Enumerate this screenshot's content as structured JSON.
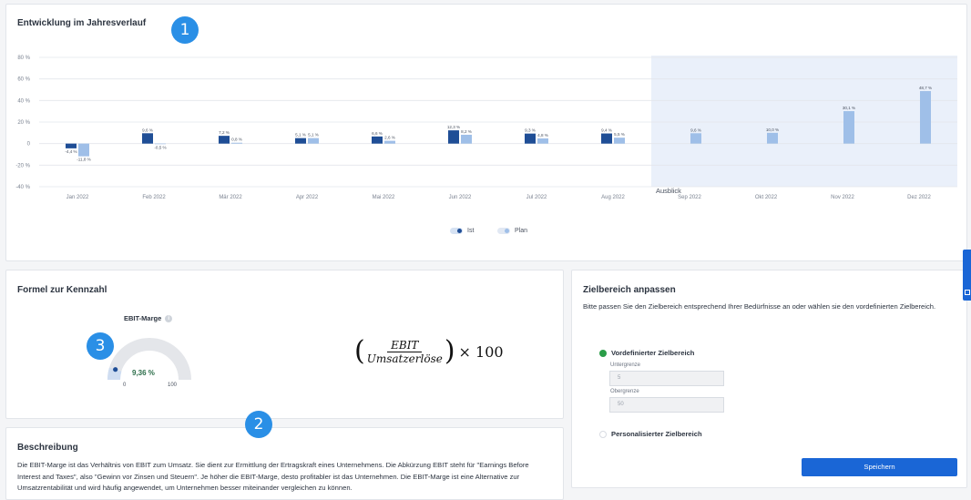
{
  "chart_section": {
    "title": "Entwicklung im Jahresverlauf",
    "badge": "1",
    "outlook_label": "Ausblick",
    "legend": [
      {
        "label": "Ist",
        "color": "#1f4e96"
      },
      {
        "label": "Plan",
        "color": "#9fbfe8"
      }
    ]
  },
  "chart_data": {
    "type": "bar",
    "title": "Entwicklung im Jahresverlauf",
    "categories": [
      "Jan 2022",
      "Feb 2022",
      "Mär 2022",
      "Apr 2022",
      "Mai 2022",
      "Jun 2022",
      "Jul 2022",
      "Aug 2022",
      "Sep 2022",
      "Okt 2022",
      "Nov 2022",
      "Dez 2022"
    ],
    "y_ticks": [
      "80 %",
      "60 %",
      "40 %",
      "20 %",
      "0",
      "-20 %",
      "-40 %"
    ],
    "ylim": [
      -40,
      80
    ],
    "series": [
      {
        "name": "Ist",
        "color": "#1f4e96",
        "values": [
          -4.4,
          9.6,
          7.2,
          5.1,
          6.6,
          12.3,
          9.3,
          9.4,
          null,
          null,
          null,
          null
        ],
        "labels": [
          "-4,4 %",
          "9,6 %",
          "7,2 %",
          "5,1 %",
          "6,6 %",
          "12,3 %",
          "9,3 %",
          "9,4 %",
          "",
          "",
          "",
          ""
        ]
      },
      {
        "name": "Plan",
        "color": "#9fbfe8",
        "values": [
          -11.8,
          -0.5,
          0.8,
          5.1,
          2.6,
          8.2,
          4.8,
          5.5,
          9.6,
          10.0,
          30.1,
          48.7
        ],
        "labels": [
          "-11,8 %",
          "-0,5 %",
          "0,8 %",
          "5,1 %",
          "2,6 %",
          "8,2 %",
          "4,8 %",
          "5,5 %",
          "9,6 %",
          "10,0 %",
          "30,1 %",
          "48,7 %"
        ]
      }
    ],
    "outlook_from": "Sep 2022",
    "grid": true,
    "legend_position": "bottom-center"
  },
  "formula_section": {
    "title": "Formel zur Kennzahl",
    "badge": "3",
    "gauge": {
      "label": "EBIT-Marge",
      "value_text": "9,36 %",
      "value": 9.36,
      "min": "0",
      "max": "100"
    },
    "formula": {
      "numerator": "EBIT",
      "denominator": "Umsatzerlöse",
      "multiplier": "× 100"
    }
  },
  "description_section": {
    "title": "Beschreibung",
    "badge": "2",
    "text": "Die EBIT-Marge ist das Verhältnis von EBIT zum Umsatz. Sie dient zur Ermittlung der Ertragskraft eines Unternehmens. Die Abkürzung EBIT steht für \"Earnings Before Interest and Taxes\", also \"Gewinn vor Zinsen und Steuern\". Je höher die EBIT-Marge, desto profitabler ist das Unternehmen. Die EBIT-Marge ist eine Alternative zur Umsatzrentabilität und wird häufig angewendet, um Unternehmen besser miteinander vergleichen zu können."
  },
  "target_section": {
    "title": "Zielbereich anpassen",
    "intro": "Bitte passen Sie den Zielbereich entsprechend Ihrer Bedürfnisse an oder wählen sie den vordefinierten Zielbereich.",
    "predefined_label": "Vordefinierter Zielbereich",
    "lower_label": "Untergrenze",
    "lower_value": "5",
    "upper_label": "Obergrenze",
    "upper_value": "50",
    "custom_label": "Personalisierter Zielbereich",
    "save_label": "Speichern",
    "accent": "#1a66d6",
    "selected_color": "#2a9d48"
  }
}
